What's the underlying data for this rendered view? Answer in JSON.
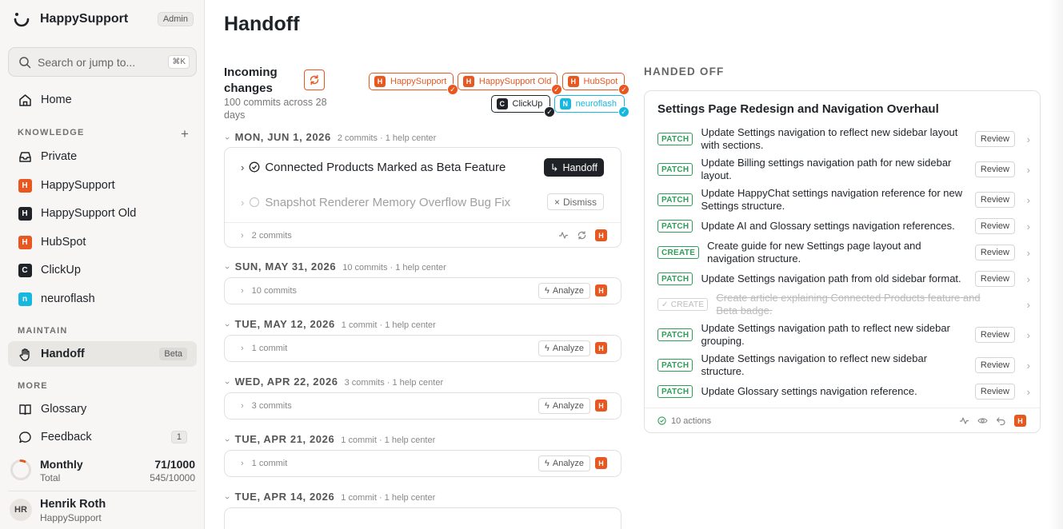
{
  "app": {
    "name": "HappySupport",
    "role_badge": "Admin"
  },
  "search": {
    "placeholder": "Search or jump to...",
    "shortcut": "⌘K"
  },
  "nav": {
    "home": "Home",
    "knowledge_label": "KNOWLEDGE",
    "knowledge_items": [
      {
        "label": "Private",
        "icon": "inbox-icon"
      },
      {
        "label": "HappySupport",
        "letter": "H",
        "color": "#e8571f"
      },
      {
        "label": "HappySupport Old",
        "letter": "H",
        "color": "#1f2328"
      },
      {
        "label": "HubSpot",
        "letter": "H",
        "color": "#e8571f"
      },
      {
        "label": "ClickUp",
        "letter": "C",
        "color": "#1f2328"
      },
      {
        "label": "neuroflash",
        "letter": "n",
        "color": "#16b8e0"
      }
    ],
    "maintain_label": "MAINTAIN",
    "handoff": {
      "label": "Handoff",
      "badge": "Beta"
    },
    "more_label": "MORE",
    "glossary": "Glossary",
    "feedback": {
      "label": "Feedback",
      "count": "1"
    }
  },
  "usage": {
    "title": "Monthly",
    "subtitle": "Total",
    "monthly": "71/1000",
    "total": "545/10000",
    "fraction": 0.071
  },
  "user": {
    "initials": "HR",
    "name": "Henrik Roth",
    "org": "HappySupport"
  },
  "page": {
    "title": "Handoff"
  },
  "incoming": {
    "title": "Incoming changes",
    "subtitle": "100 commits across 28 days",
    "sources": [
      {
        "label": "HappySupport",
        "letter": "H",
        "color": "#e8571f"
      },
      {
        "label": "HappySupport Old",
        "letter": "H",
        "color": "#e8571f"
      },
      {
        "label": "HubSpot",
        "letter": "H",
        "color": "#e8571f"
      },
      {
        "label": "ClickUp",
        "letter": "C",
        "color": "#1f2328"
      },
      {
        "label": "neuroflash",
        "letter": "N",
        "color": "#16b8e0"
      }
    ]
  },
  "days": [
    {
      "date": "MON, JUN 1, 2026",
      "meta": "2 commits · 1 help center",
      "commits": [
        {
          "title": "Connected Products Marked as Beta Feature",
          "action": "Handoff"
        },
        {
          "title": "Snapshot Renderer Memory Overflow Bug Fix",
          "action": "Dismiss"
        }
      ],
      "footer": "2 commits"
    },
    {
      "date": "SUN, MAY 31, 2026",
      "meta": "10 commits · 1 help center",
      "row": "10 commits",
      "action": "Analyze"
    },
    {
      "date": "TUE, MAY 12, 2026",
      "meta": "1 commit · 1 help center",
      "row": "1 commit",
      "action": "Analyze"
    },
    {
      "date": "WED, APR 22, 2026",
      "meta": "3 commits · 1 help center",
      "row": "3 commits",
      "action": "Analyze"
    },
    {
      "date": "TUE, APR 21, 2026",
      "meta": "1 commit · 1 help center",
      "row": "1 commit",
      "action": "Analyze"
    },
    {
      "date": "TUE, APR 14, 2026",
      "meta": "1 commit · 1 help center"
    }
  ],
  "handed_off": {
    "label": "HANDED OFF",
    "title": "Settings Page Redesign and Navigation Overhaul",
    "review_label": "Review",
    "actions": [
      {
        "tag": "PATCH",
        "text": "Update Settings navigation to reflect new sidebar layout with sections."
      },
      {
        "tag": "PATCH",
        "text": "Update Billing settings navigation path for new sidebar layout."
      },
      {
        "tag": "PATCH",
        "text": "Update HappyChat settings navigation reference for new Settings structure."
      },
      {
        "tag": "PATCH",
        "text": "Update AI and Glossary settings navigation references."
      },
      {
        "tag": "CREATE",
        "text": "Create guide for new Settings page layout and navigation structure."
      },
      {
        "tag": "PATCH",
        "text": "Update Settings navigation path from old sidebar format."
      },
      {
        "tag": "✓ CREATE",
        "text": "Create article explaining Connected Products feature and Beta badge.",
        "done": true
      },
      {
        "tag": "PATCH",
        "text": "Update Settings navigation path to reflect new sidebar grouping."
      },
      {
        "tag": "PATCH",
        "text": "Update Settings navigation to reflect new sidebar structure."
      },
      {
        "tag": "PATCH",
        "text": "Update Glossary settings navigation reference."
      }
    ],
    "footer": "10 actions"
  },
  "colors": {
    "accent": "#e8571f",
    "patch_green": "#2e9d57",
    "dark": "#1f2328",
    "cyan": "#16b8e0"
  }
}
